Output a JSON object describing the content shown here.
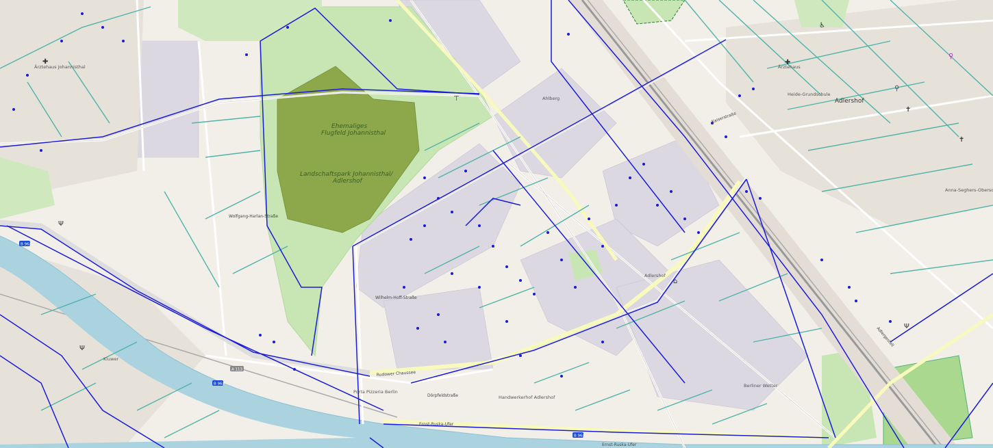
{
  "map": {
    "park_labels": [
      "Ehemaliges",
      "Flugfeld Johannisthal",
      "Landschaftspark Johannisthal/",
      "Adlershof"
    ],
    "place_labels": [
      "Adlershof",
      "Ärztehaus",
      "Ärztehaus Johannisthal",
      "Heide-Grundschule",
      "Anna-Seghers-Oberschule",
      "Ahlberg",
      "Kluwer",
      "Porta Pizzeria Berlin",
      "Adlershof",
      "Handwerkerhof Adlershof",
      "Berliner Wetter"
    ],
    "street_labels": [
      "Wolfgang-Harlan-Straße",
      "Rudower Chaussee",
      "Ernst-Ruska-Ufer",
      "Kaiserstraße",
      "Wilhelm-Hoff-Straße",
      "Adlergestell",
      "Dörpfeldstraße",
      "Ernst-Ruska-Ufer"
    ],
    "road_shields": [
      "B 96a",
      "B 96a",
      "A 113",
      "B 96a"
    ],
    "colors": {
      "background": "#f2efe9",
      "residential": "#e0dfdf",
      "park": "#c8e6b4",
      "meadow": "#8da84a",
      "water": "#aad3df",
      "cycleway": "#1a1ad9",
      "footway": "#4fb3a8",
      "rail": "#999999"
    }
  }
}
